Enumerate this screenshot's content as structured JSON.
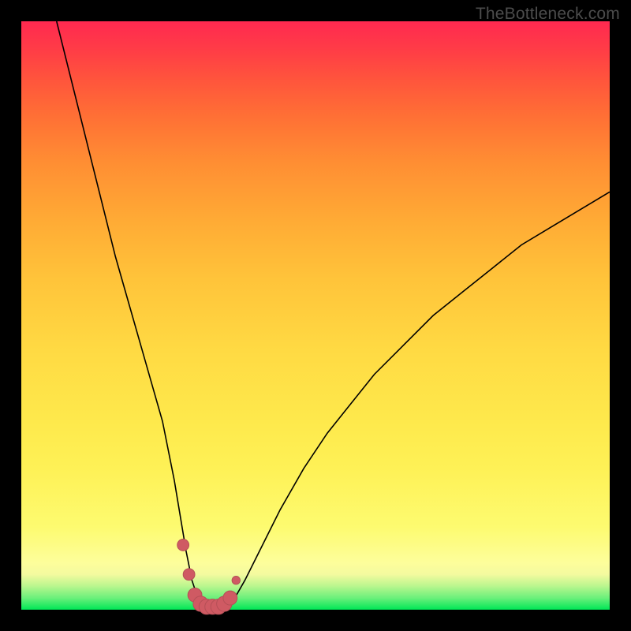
{
  "watermark": "TheBottleneck.com",
  "colors": {
    "frame": "#000000",
    "curve_stroke": "#000000",
    "marker_fill": "#cf5a63",
    "marker_stroke": "#b24e55"
  },
  "chart_data": {
    "type": "line",
    "title": "",
    "xlabel": "",
    "ylabel": "",
    "xlim": [
      0,
      100
    ],
    "ylim": [
      0,
      100
    ],
    "grid": false,
    "curve": {
      "name": "bottleneck-curve",
      "x": [
        6,
        8,
        10,
        12,
        14,
        16,
        18,
        20,
        22,
        24,
        26,
        27,
        28,
        29,
        30,
        31,
        32,
        33,
        34,
        35,
        36,
        38,
        40,
        42,
        44,
        48,
        52,
        56,
        60,
        65,
        70,
        75,
        80,
        85,
        90,
        95,
        100
      ],
      "y": [
        100,
        92,
        84,
        76,
        68,
        60,
        53,
        46,
        39,
        32,
        22,
        16,
        10,
        5,
        2,
        0.5,
        0,
        0,
        0,
        0.5,
        1.5,
        5,
        9,
        13,
        17,
        24,
        30,
        35,
        40,
        45,
        50,
        54,
        58,
        62,
        65,
        68,
        71
      ]
    },
    "markers": {
      "name": "bottleneck-zone",
      "x": [
        27.5,
        28.5,
        29.5,
        30.5,
        31.5,
        32.5,
        33.5,
        34.5,
        35.5,
        36.5
      ],
      "y": [
        11,
        6,
        2.5,
        1,
        0.5,
        0.5,
        0.5,
        1,
        2,
        5
      ],
      "r": [
        1.0,
        1.0,
        1.2,
        1.3,
        1.3,
        1.3,
        1.3,
        1.3,
        1.2,
        0.7
      ]
    }
  }
}
